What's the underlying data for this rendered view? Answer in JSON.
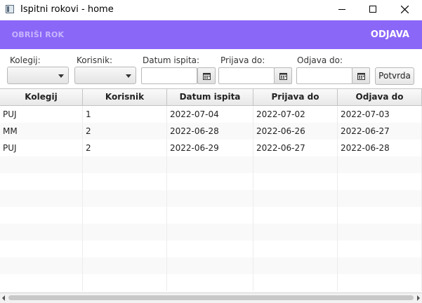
{
  "window": {
    "title": "Ispitni rokovi - home"
  },
  "toolbar": {
    "delete_label": "OBRIŠI ROK",
    "logout_label": "ODJAVA",
    "accent": "#8b67f8"
  },
  "filters": {
    "kolegij_label": "Kolegij:",
    "korisnik_label": "Korisnik:",
    "datum_label": "Datum ispita:",
    "prijava_label": "Prijava do:",
    "odjava_label": "Odjava do:",
    "confirm_label": "Potvrda",
    "kolegij_value": "",
    "korisnik_value": "",
    "datum_value": "",
    "prijava_value": "",
    "odjava_value": ""
  },
  "table": {
    "columns": [
      "Kolegij",
      "Korisnik",
      "Datum ispita",
      "Prijava do",
      "Odjava do"
    ],
    "rows": [
      [
        "PUJ",
        "1",
        "2022-07-04",
        "2022-07-02",
        "2022-07-03"
      ],
      [
        "MM",
        "2",
        "2022-06-28",
        "2022-06-26",
        "2022-06-27"
      ],
      [
        "PUJ",
        "2",
        "2022-06-29",
        "2022-06-27",
        "2022-06-28"
      ]
    ],
    "empty_rows": 8
  }
}
